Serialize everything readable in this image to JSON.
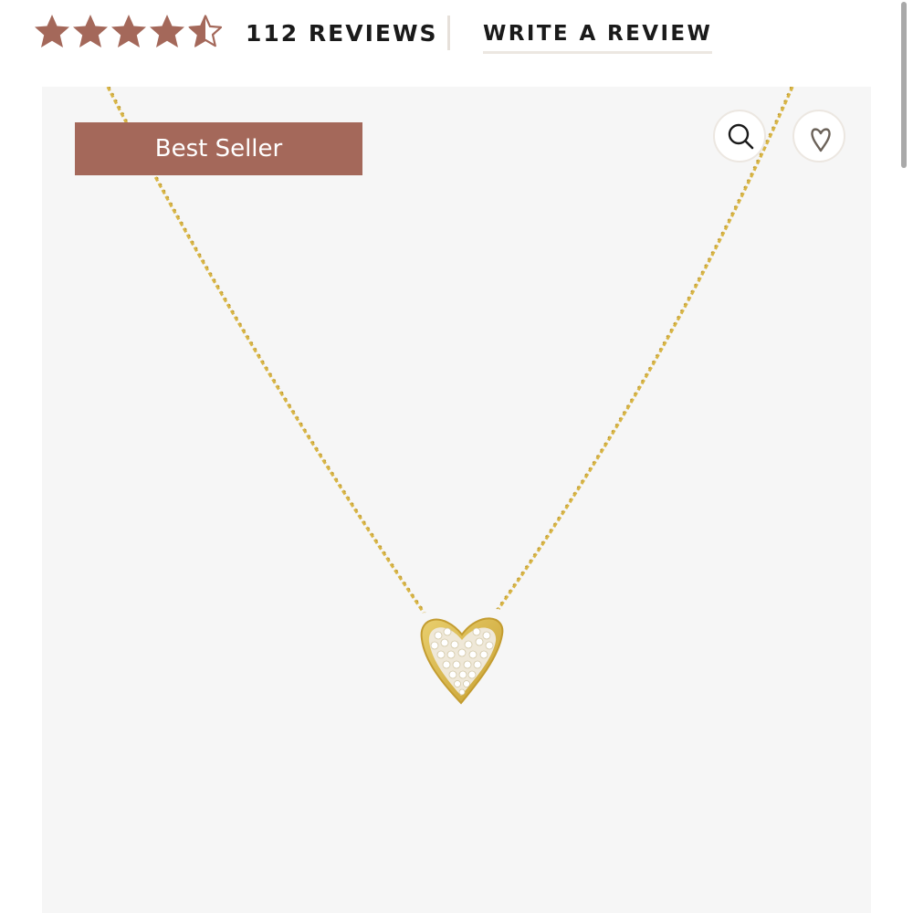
{
  "reviews": {
    "rating": 4.5,
    "max_rating": 5,
    "count_label": "112 REVIEWS",
    "write_review_label": "WRITE A REVIEW",
    "star_color": "#a4685a"
  },
  "product_image": {
    "badge_label": "Best Seller",
    "badge_color": "#a4685a",
    "background_color": "#f6f6f6",
    "chain_color": "#d4b13e",
    "zoom_icon": "search-icon",
    "wishlist_icon": "heart-icon"
  }
}
